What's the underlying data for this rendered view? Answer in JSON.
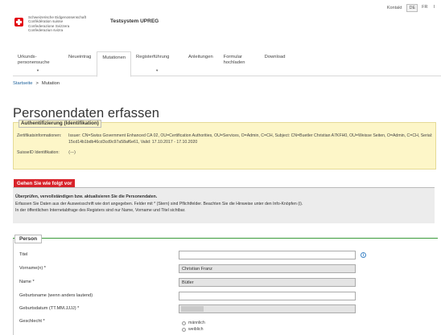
{
  "topnav": {
    "contact": "Kontakt",
    "languages": [
      "DE",
      "FR",
      "I"
    ]
  },
  "header": {
    "confederation": [
      "Schweizerische Eidgenossenschaft",
      "Confédération suisse",
      "Confederazione Svizzera",
      "Confederaziun svizra"
    ],
    "system_title": "Testsystem UPREG",
    "flag_icon": "swiss-flag-icon"
  },
  "menu": {
    "items": [
      {
        "label": "Urkunds-\npersonensuche",
        "caret": "▼"
      },
      {
        "label": "Neueintrag"
      },
      {
        "label": "Mutationen"
      },
      {
        "label": "Registerführung",
        "caret": "▼"
      },
      {
        "label": "Anleitungen"
      },
      {
        "label": "Formular\nhochladen"
      },
      {
        "label": "Download"
      }
    ],
    "active_index": 2
  },
  "breadcrumb": {
    "home": "Startseite",
    "separator": ">",
    "current": "Mutation"
  },
  "page_title": "Personendaten erfassen",
  "auth": {
    "legend": "Authentifizierung (Identifikation)",
    "cert_label": "Zertifikatsinformationen:",
    "cert_value": "Issuer: CN=Swiss Government Enhanced CA 02, OU=Certification Authorities, OU=Services, O=Admin, C=CH, Subject: CN=Buetler Christian A7KFH0, OU=Weisse Seiten, O=Admin, C=CH, Serial: 15cd14b1bdb46cd3cd9c97a58af6e61, Valid: 17.10.2017 - 17.10.2020",
    "suisseid_label": "SuisseID Identifikation:",
    "suisseid_value": "(---)"
  },
  "instructions": {
    "tag": "Gehen Sie wie folgt vor",
    "line1": "Überprüfen, vervollständigen bzw. aktualisieren Sie die Personendaten.",
    "line2": "Erfassen Sie Daten aus der Ausweisschrift wie dort angegeben. Felder mit * (Stern) sind Pflichtfelder. Beachten Sie die Hinweise unter den Info-Knöpfen (i).",
    "line3": "In der öffentlichen Internetabfrage des Registers sind nur Name, Vorname und Titel sichtbar."
  },
  "person": {
    "legend": "Person",
    "fields": {
      "titel": {
        "label": "Titel",
        "value": ""
      },
      "vorname": {
        "label": "Vorname(n) *",
        "value": "Christian Franz"
      },
      "name": {
        "label": "Name *",
        "value": "Bütler"
      },
      "geburtsname": {
        "label": "Geburtsname (wenn anders lautend)",
        "value": ""
      },
      "geburtsdatum": {
        "label": "Geburtsdatum (TT.MM.JJJJ) *",
        "value": ""
      },
      "geschlecht": {
        "label": "Geschlecht *",
        "options": [
          "männlich",
          "weiblich"
        ]
      }
    },
    "info_symbol": "i"
  }
}
